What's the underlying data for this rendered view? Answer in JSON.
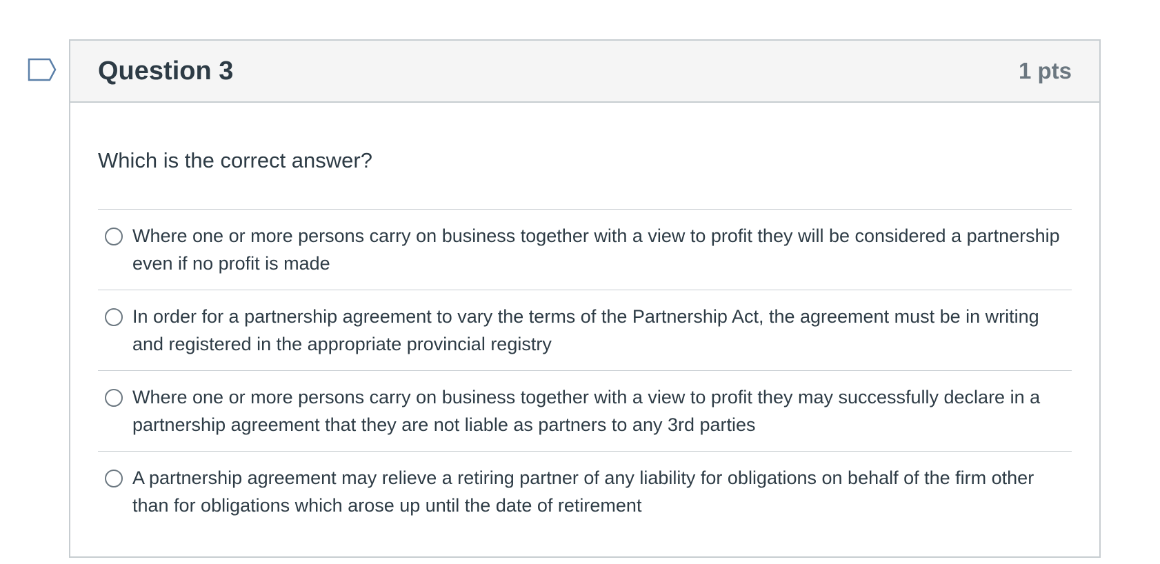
{
  "question": {
    "title": "Question 3",
    "points": "1 pts",
    "prompt": "Which is the correct answer?",
    "answers": [
      {
        "label": "Where one or more persons carry on business together with a view to profit they will be considered a partnership even if no profit is made",
        "selected": false
      },
      {
        "label": "In order for a partnership agreement to vary the terms of the Partnership Act, the agreement must be in writing and registered in the appropriate provincial registry",
        "selected": false
      },
      {
        "label": "Where one or more persons carry on business together with a view to profit they may successfully declare in a partnership agreement that they are not liable as partners to any 3rd parties",
        "selected": false
      },
      {
        "label": "A partnership agreement may relieve a retiring partner of any liability for obligations on behalf of the firm other than for obligations which arose up until the date of retirement",
        "selected": false
      }
    ]
  },
  "colors": {
    "border": "#c7cdd1",
    "header_bg": "#f5f5f5",
    "text": "#2d3b45",
    "muted": "#6b7780",
    "flag_outline": "#5a7fa8"
  },
  "icons": {
    "flag": "flag-question-icon"
  }
}
